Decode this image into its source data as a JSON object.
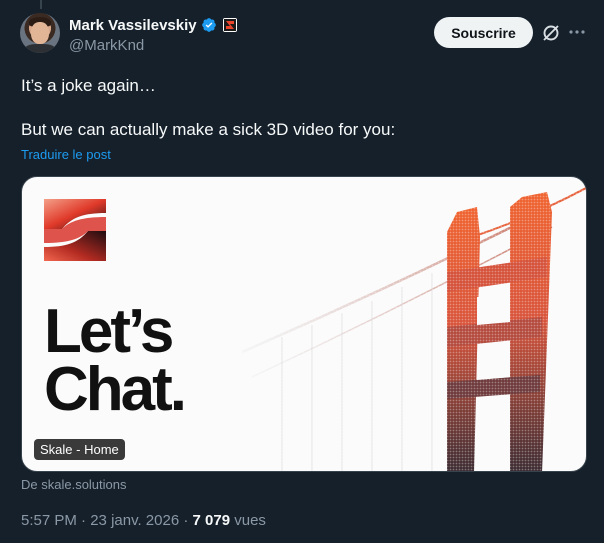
{
  "author": {
    "display_name": "Mark Vassilevskiy",
    "handle": "@MarkKnd",
    "avatar_icon": "avatar-photo",
    "verified_icon": "verified-badge-icon",
    "affiliate_icon": "skale-affiliate-icon"
  },
  "header": {
    "subscribe_label": "Souscrire",
    "grok_icon": "grok-icon",
    "more_icon": "more-options-icon"
  },
  "tweet": {
    "line1": "It’s a joke again…",
    "line2": "But we can actually make a sick 3D video for you:",
    "translate_label": "Traduire le post"
  },
  "card": {
    "headline_line1": "Let’s",
    "headline_line2": "Chat.",
    "title": "Skale - Home",
    "source": "De skale.solutions"
  },
  "meta": {
    "time": "5:57 PM",
    "separator": "·",
    "date": "23 janv. 2026",
    "views_count": "7 079",
    "views_label": "vues"
  },
  "colors": {
    "background": "#15202b",
    "link": "#1d9bf0",
    "muted": "#8b98a5",
    "verified": "#1d9bf0"
  }
}
